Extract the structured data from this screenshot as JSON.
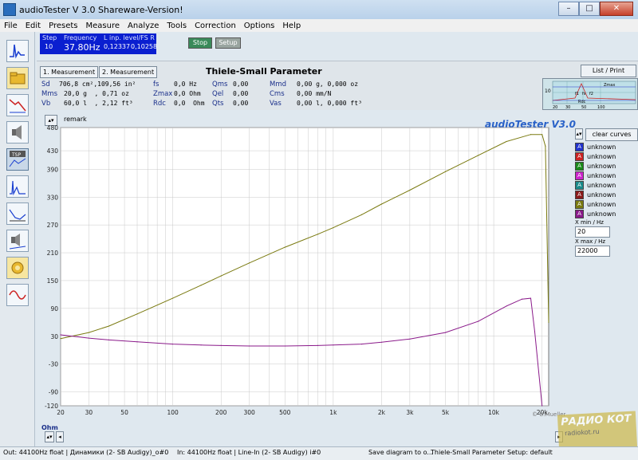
{
  "window": {
    "title": "audioTester  V 3.0 Shareware-Version!",
    "min": "–",
    "max": "□",
    "close": "✕"
  },
  "menu": [
    "File",
    "Edit",
    "Presets",
    "Measure",
    "Analyze",
    "Tools",
    "Correction",
    "Options",
    "Help"
  ],
  "status": {
    "step_label": "Step",
    "step_value": "10",
    "freq_label": "Frequency",
    "freq_value": "37.80Hz",
    "level_label": "L inp. level/FS R",
    "level_l": "0,12337",
    "level_r": "0,10258"
  },
  "toolbar": {
    "stop": "Stop",
    "setup": "Setup"
  },
  "tsp": {
    "meas1": "1. Measurement",
    "meas2": "2. Measurement",
    "title": "Thiele-Small Parameter",
    "list_print": "List / Print",
    "col1": [
      {
        "label": "Sd",
        "value": "706,8 cm²,109,56 in²"
      },
      {
        "label": "Mms",
        "value": "20,0 g  , 0,71 oz"
      },
      {
        "label": "Vb",
        "value": "60,0 l  , 2,12 ft³"
      }
    ],
    "col2": [
      {
        "label": "fs",
        "value": "0,0 Hz"
      },
      {
        "label": "Zmax",
        "value": "0,0 Ohm"
      },
      {
        "label": "Rdc",
        "value": "0,0  Ohm"
      }
    ],
    "col3": [
      {
        "label": "Qms",
        "value": "0,00"
      },
      {
        "label": "Qel",
        "value": "0,00"
      },
      {
        "label": "Qts",
        "value": "0,00"
      }
    ],
    "col4": [
      {
        "label": "Mmd",
        "value": "0,00 g, 0,000 oz"
      },
      {
        "label": "Cms",
        "value": "0,00 mm/N"
      },
      {
        "label": "Vas",
        "value": "0,00 l, 0,000 ft³"
      }
    ],
    "mini": {
      "y10": "10",
      "zmax": "Zmax",
      "rdc": "Rdc",
      "fs": "fs",
      "f1": "f1",
      "f2": "f2",
      "x20": "20",
      "x30": "30",
      "x50": "50",
      "x100": "100"
    }
  },
  "chart_panel": {
    "remark": "remark",
    "brand": "audioTester  V3.0",
    "clear_curves": "clear curves",
    "legend": [
      {
        "letter": "A",
        "label": "unknown",
        "color": "#2233cc"
      },
      {
        "letter": "A",
        "label": "unknown",
        "color": "#cc2222"
      },
      {
        "letter": "A",
        "label": "unknown",
        "color": "#1a8a1a"
      },
      {
        "letter": "A",
        "label": "unknown",
        "color": "#cc22cc"
      },
      {
        "letter": "A",
        "label": "unknown",
        "color": "#1a8a8a"
      },
      {
        "letter": "A",
        "label": "unknown",
        "color": "#8a1a1a"
      },
      {
        "letter": "A",
        "label": "unknown",
        "color": "#7a7a10"
      },
      {
        "letter": "A",
        "label": "unknown",
        "color": "#8a1a8a"
      }
    ],
    "xmin_label": "X min / Hz",
    "xmin_value": "20",
    "xmax_label": "X max / Hz",
    "xmax_value": "22000",
    "unit": "Ohm",
    "copyright": "© U.Mueller"
  },
  "chart_data": {
    "type": "line",
    "x_scale": "log",
    "xlim": [
      20,
      22000
    ],
    "ylim": [
      -120,
      480
    ],
    "x_ticks": [
      20,
      30,
      50,
      100,
      200,
      300,
      500,
      "1k",
      "2k",
      "3k",
      "5k",
      "10k",
      "20k"
    ],
    "x_tick_values": [
      20,
      30,
      50,
      100,
      200,
      300,
      500,
      1000,
      2000,
      3000,
      5000,
      10000,
      20000
    ],
    "y_ticks": [
      480,
      430,
      390,
      330,
      270,
      210,
      150,
      90,
      30,
      -30,
      -90,
      -120
    ],
    "y_tick_labels": [
      "480",
      "430",
      "390",
      "330",
      "270",
      "210",
      "150",
      "90",
      "30",
      "-30",
      "-90",
      "-120"
    ],
    "grid": true,
    "series": [
      {
        "color": "#7a7a10",
        "x": [
          20,
          30,
          40,
          60,
          100,
          150,
          200,
          300,
          500,
          800,
          1000,
          1500,
          2000,
          3000,
          5000,
          8000,
          12000,
          17000,
          20000,
          21000,
          22000
        ],
        "y": [
          25,
          38,
          52,
          78,
          112,
          140,
          160,
          188,
          222,
          250,
          264,
          292,
          315,
          345,
          385,
          420,
          450,
          465,
          465,
          440,
          60
        ]
      },
      {
        "color": "#8a1a8a",
        "x": [
          20,
          30,
          40,
          60,
          100,
          150,
          200,
          300,
          500,
          800,
          1000,
          1500,
          2000,
          3000,
          5000,
          8000,
          12000,
          15000,
          17000,
          18000,
          20000
        ],
        "y": [
          33,
          26,
          22,
          18,
          13,
          11,
          10,
          9,
          9,
          10,
          11,
          13,
          17,
          24,
          38,
          62,
          95,
          110,
          112,
          40,
          -120
        ]
      }
    ]
  },
  "bottom": {
    "out": "Out: 44100Hz float  | Динамики (2- SB Audigy)_o#0",
    "in": "In: 44100Hz float  | Line-In (2- SB Audigy) i#0",
    "save": "Save diagram to o...",
    "mode": "Thiele-Small Parameter Setup: default"
  },
  "watermark": {
    "line1": "РАДИО КОТ",
    "line2": "radiokot.ru"
  }
}
